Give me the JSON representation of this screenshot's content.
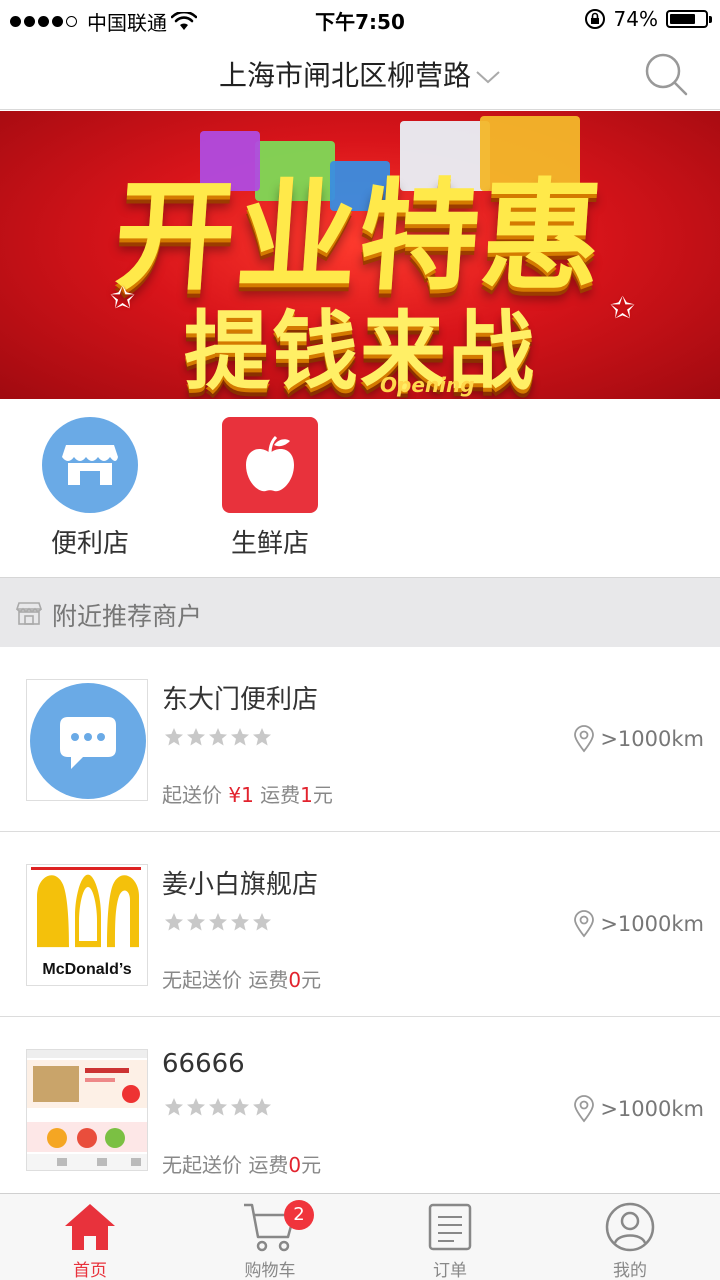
{
  "status_bar": {
    "carrier": "中国联通",
    "time": "下午7:50",
    "battery": "74%",
    "battery_level": 0.74,
    "signal_dots_filled": 4
  },
  "header": {
    "location": "上海市闸北区柳营路",
    "icons": {
      "dropdown": "chevron-down-icon",
      "search": "search-icon"
    }
  },
  "banner": {
    "line1": "开业特惠",
    "line2": "提钱来战",
    "caption": "Opening"
  },
  "categories": [
    {
      "label": "便利店",
      "icon": "storefront-icon",
      "color": "#6aaae6"
    },
    {
      "label": "生鲜店",
      "icon": "apple-icon",
      "color": "#e8323c"
    }
  ],
  "section": {
    "title": "附近推荐商户",
    "icon": "shop-icon"
  },
  "stores": [
    {
      "name": "东大门便利店",
      "distance": ">1000km",
      "rating": 0,
      "min_label": "起送价",
      "min_value": "¥1",
      "fee_label": "运费",
      "fee_value": "1",
      "fee_unit": "元"
    },
    {
      "name": "姜小白旗舰店",
      "distance": ">1000km",
      "rating": 0,
      "min_label": "无起送价",
      "min_value": "",
      "fee_label": "运费",
      "fee_value": "0",
      "fee_unit": "元",
      "logo_text": "McDonald’s"
    },
    {
      "name": "66666",
      "distance": ">1000km",
      "rating": 0,
      "min_label": "无起送价",
      "min_value": "",
      "fee_label": "运费",
      "fee_value": "0",
      "fee_unit": "元"
    }
  ],
  "tabbar": {
    "items": [
      {
        "label": "首页",
        "icon": "home-icon",
        "active": true
      },
      {
        "label": "购物车",
        "icon": "cart-icon",
        "badge": "2"
      },
      {
        "label": "订单",
        "icon": "order-icon"
      },
      {
        "label": "我的",
        "icon": "profile-icon"
      }
    ]
  },
  "colors": {
    "accent": "#e8323c",
    "blue": "#6aaae6",
    "section_bg": "#e8e8ea"
  }
}
